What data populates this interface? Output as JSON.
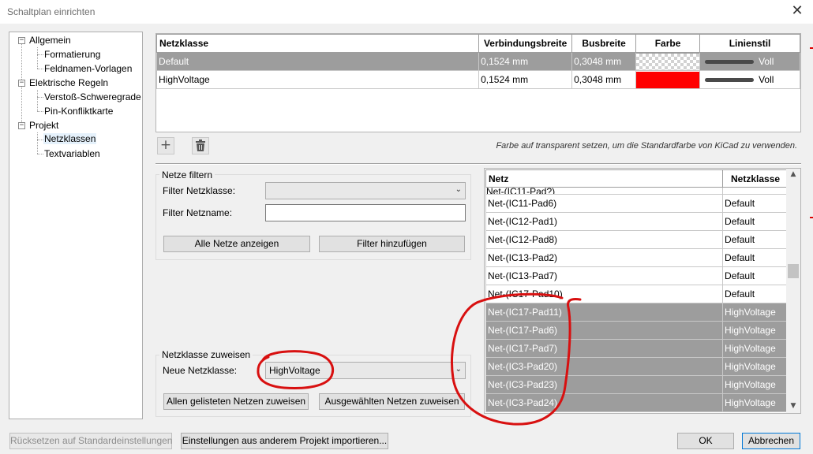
{
  "window": {
    "title": "Schaltplan einrichten",
    "close_glyph": "✕"
  },
  "tree": {
    "items": [
      {
        "label": "Allgemein",
        "level": 0,
        "expander": "−"
      },
      {
        "label": "Formatierung",
        "level": 1
      },
      {
        "label": "Feldnamen-Vorlagen",
        "level": 1
      },
      {
        "label": "Elektrische Regeln",
        "level": 0,
        "expander": "−"
      },
      {
        "label": "Verstoß-Schweregrade",
        "level": 1
      },
      {
        "label": "Pin-Konfliktkarte",
        "level": 1
      },
      {
        "label": "Projekt",
        "level": 0,
        "expander": "−"
      },
      {
        "label": "Netzklassen",
        "level": 1,
        "selected": true
      },
      {
        "label": "Textvariablen",
        "level": 1
      }
    ]
  },
  "netclasses": {
    "columns": [
      "Netzklasse",
      "Verbindungsbreite",
      "Busbreite",
      "Farbe",
      "Linienstil"
    ],
    "rows": [
      {
        "name": "Default",
        "wire_width": "0,1524 mm",
        "bus_width": "0,3048 mm",
        "color": "transparent",
        "line_style": "Voll",
        "selected": true
      },
      {
        "name": "HighVoltage",
        "wire_width": "0,1524 mm",
        "bus_width": "0,3048 mm",
        "color": "#ff0000",
        "line_style": "Voll",
        "selected": false
      }
    ],
    "add_icon": "plus-icon",
    "delete_icon": "trash-icon",
    "hint": "Farbe auf transparent setzen, um die Standardfarbe von KiCad zu verwenden."
  },
  "filter": {
    "group_label": "Netze filtern",
    "netclass_label": "Filter Netzklasse:",
    "netclass_value": "",
    "netname_label": "Filter Netzname:",
    "netname_value": "",
    "show_all_button": "Alle Netze anzeigen",
    "add_filter_button": "Filter hinzufügen"
  },
  "assign": {
    "group_label": "Netzklasse zuweisen",
    "new_class_label": "Neue Netzklasse:",
    "new_class_value": "HighVoltage",
    "assign_listed_button": "Allen gelisteten Netzen zuweisen",
    "assign_selected_button": "Ausgewählten Netzen zuweisen"
  },
  "nets": {
    "columns": [
      "Netz",
      "Netzklasse"
    ],
    "partial_top": "Net-(IC11-Pad?)",
    "rows": [
      {
        "net": "Net-(IC11-Pad6)",
        "class": "Default",
        "selected": false
      },
      {
        "net": "Net-(IC12-Pad1)",
        "class": "Default",
        "selected": false
      },
      {
        "net": "Net-(IC12-Pad8)",
        "class": "Default",
        "selected": false
      },
      {
        "net": "Net-(IC13-Pad2)",
        "class": "Default",
        "selected": false
      },
      {
        "net": "Net-(IC13-Pad7)",
        "class": "Default",
        "selected": false
      },
      {
        "net": "Net-(IC17-Pad10)",
        "class": "Default",
        "selected": false
      },
      {
        "net": "Net-(IC17-Pad11)",
        "class": "HighVoltage",
        "selected": true
      },
      {
        "net": "Net-(IC17-Pad6)",
        "class": "HighVoltage",
        "selected": true
      },
      {
        "net": "Net-(IC17-Pad7)",
        "class": "HighVoltage",
        "selected": true
      },
      {
        "net": "Net-(IC3-Pad20)",
        "class": "HighVoltage",
        "selected": true
      },
      {
        "net": "Net-(IC3-Pad23)",
        "class": "HighVoltage",
        "selected": true
      },
      {
        "net": "Net-(IC3-Pad24)",
        "class": "HighVoltage",
        "selected": true
      }
    ]
  },
  "footer": {
    "reset_button": "Rücksetzen auf Standardeinstellungen",
    "import_button": "Einstellungen aus anderem Projekt importieren...",
    "ok_button": "OK",
    "cancel_button": "Abbrechen"
  },
  "colors": {
    "selection_gray": "#9d9d9d",
    "annotation_red": "#d81010",
    "highvoltage_swatch": "#ff0000"
  }
}
